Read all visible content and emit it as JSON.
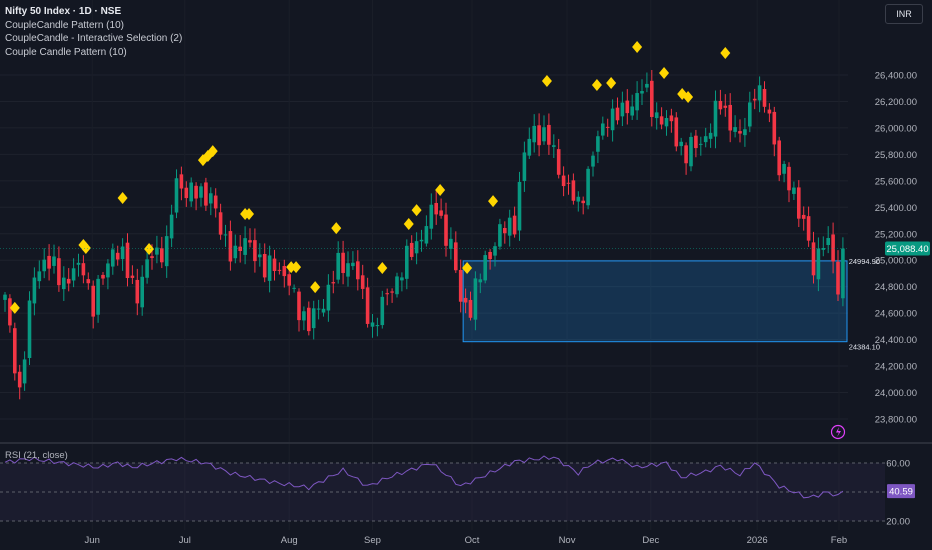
{
  "header": {
    "symbol_title": "Nifty 50 Index · 1D · NSE",
    "indicators": [
      "CoupleCandle Pattern (10)",
      "CoupleCandle - Interactive Selection (2)",
      "Couple Candle Pattern (10)"
    ],
    "currency": "INR"
  },
  "chart_data": {
    "type": "candlestick",
    "title": "Nifty 50 Index · 1D · NSE",
    "price_axis": {
      "ylim": [
        23700,
        26550
      ],
      "ticks": [
        "26,400.00",
        "26,200.00",
        "26,000.00",
        "25,800.00",
        "25,600.00",
        "25,400.00",
        "25,200.00",
        "25,000.00",
        "24,800.00",
        "24,600.00",
        "24,400.00",
        "24,200.00",
        "24,000.00",
        "23,800.00"
      ],
      "tick_values": [
        26400,
        26200,
        26000,
        25800,
        25600,
        25400,
        25200,
        25000,
        24800,
        24600,
        24400,
        24200,
        24000,
        23800
      ]
    },
    "bars": 172,
    "close_waypoints": [
      [
        0,
        24700
      ],
      [
        3,
        24000
      ],
      [
        6,
        24900
      ],
      [
        8,
        25000
      ],
      [
        12,
        24850
      ],
      [
        16,
        24950
      ],
      [
        18,
        24650
      ],
      [
        22,
        25100
      ],
      [
        24,
        25000
      ],
      [
        27,
        24750
      ],
      [
        30,
        25050
      ],
      [
        33,
        25100
      ],
      [
        35,
        25600
      ],
      [
        38,
        25500
      ],
      [
        42,
        25500
      ],
      [
        44,
        25200
      ],
      [
        47,
        25050
      ],
      [
        50,
        25150
      ],
      [
        53,
        24900
      ],
      [
        55,
        25000
      ],
      [
        58,
        24800
      ],
      [
        62,
        24500
      ],
      [
        65,
        24700
      ],
      [
        68,
        24950
      ],
      [
        71,
        25000
      ],
      [
        73,
        24700
      ],
      [
        75,
        24500
      ],
      [
        79,
        24800
      ],
      [
        82,
        25000
      ],
      [
        85,
        25200
      ],
      [
        88,
        25400
      ],
      [
        91,
        25100
      ],
      [
        93,
        24700
      ],
      [
        95,
        24650
      ],
      [
        98,
        25000
      ],
      [
        101,
        25200
      ],
      [
        104,
        25300
      ],
      [
        106,
        25800
      ],
      [
        108,
        26000
      ],
      [
        111,
        25900
      ],
      [
        114,
        25600
      ],
      [
        117,
        25400
      ],
      [
        120,
        25800
      ],
      [
        123,
        26100
      ],
      [
        126,
        26100
      ],
      [
        130,
        26300
      ],
      [
        133,
        26100
      ],
      [
        136,
        26000
      ],
      [
        139,
        25800
      ],
      [
        142,
        25900
      ],
      [
        144,
        26000
      ],
      [
        146,
        26200
      ],
      [
        150,
        25900
      ],
      [
        153,
        26300
      ],
      [
        156,
        26100
      ],
      [
        158,
        25700
      ],
      [
        161,
        25500
      ],
      [
        163,
        25300
      ],
      [
        165,
        24900
      ],
      [
        167,
        25200
      ],
      [
        169,
        25000
      ],
      [
        170,
        24700
      ],
      [
        171,
        25088.4
      ]
    ],
    "pattern_markers": [
      [
        2,
        24640
      ],
      [
        16,
        25115
      ],
      [
        16.5,
        25092
      ],
      [
        24,
        25470
      ],
      [
        29.4,
        25085
      ],
      [
        40.4,
        25757
      ],
      [
        41.4,
        25788
      ],
      [
        42.4,
        25825
      ],
      [
        49,
        25349
      ],
      [
        49.8,
        25349
      ],
      [
        58.4,
        24948
      ],
      [
        59.4,
        24948
      ],
      [
        63.3,
        24797
      ],
      [
        67.6,
        25243
      ],
      [
        77,
        24941
      ],
      [
        82.4,
        25274
      ],
      [
        84,
        25379
      ],
      [
        88.8,
        25531
      ],
      [
        94.3,
        24941
      ],
      [
        99.6,
        25447
      ],
      [
        110.6,
        26355
      ],
      [
        120.8,
        26324
      ],
      [
        123.7,
        26340
      ],
      [
        129,
        26612
      ],
      [
        134.5,
        26415
      ],
      [
        138.2,
        26256
      ],
      [
        139.4,
        26234
      ],
      [
        147,
        26566
      ]
    ],
    "selection_zone": {
      "start_bar": 93.5,
      "top": 24994.9,
      "bottom": 24384.1,
      "top_label": "24994.90",
      "bottom_label": "24384.10"
    },
    "last_price": 25088.4,
    "last_price_label": "25,088.40",
    "time_axis": {
      "labels": [
        "Jun",
        "Jul",
        "Aug",
        "Sep",
        "Oct",
        "Nov",
        "Dec",
        "2026",
        "Feb"
      ],
      "bar_index": [
        17.8,
        36.7,
        58,
        75,
        95.3,
        114.7,
        131.8,
        153.5,
        170.2
      ]
    },
    "rsi": {
      "label": "RSI (21, close)",
      "levels": [
        60,
        40,
        20
      ],
      "level_labels": [
        "60.00",
        "20.00"
      ],
      "ylim": [
        12,
        72
      ],
      "value": 40.59,
      "value_label": "40.59",
      "waypoints": [
        [
          0,
          60.5
        ],
        [
          5,
          63
        ],
        [
          12,
          60
        ],
        [
          19,
          57
        ],
        [
          23,
          60
        ],
        [
          26,
          57
        ],
        [
          35,
          63
        ],
        [
          41,
          60
        ],
        [
          46,
          53
        ],
        [
          50,
          50
        ],
        [
          56,
          46
        ],
        [
          62,
          43
        ],
        [
          69,
          55
        ],
        [
          74,
          44
        ],
        [
          79,
          51
        ],
        [
          87,
          60
        ],
        [
          93,
          44
        ],
        [
          97,
          50
        ],
        [
          104,
          61
        ],
        [
          109,
          63
        ],
        [
          112,
          64
        ],
        [
          117,
          53
        ],
        [
          120,
          60
        ],
        [
          125,
          63
        ],
        [
          129,
          57
        ],
        [
          135,
          60
        ],
        [
          138,
          50
        ],
        [
          143,
          54
        ],
        [
          146,
          58
        ],
        [
          150,
          52
        ],
        [
          153,
          60
        ],
        [
          158,
          44
        ],
        [
          164,
          36
        ],
        [
          168,
          40
        ],
        [
          170.5,
          36
        ],
        [
          171,
          40.59
        ]
      ]
    },
    "colors": {
      "up": "#089981",
      "down": "#f23645",
      "marker": "#ffd600",
      "zone": "#2962ff",
      "rsi": "#7e57c2",
      "bg": "#131722"
    }
  }
}
